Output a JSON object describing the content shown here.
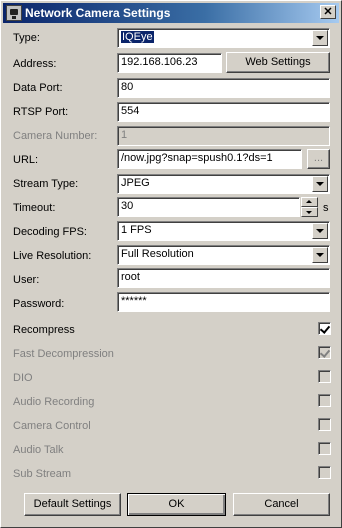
{
  "window": {
    "title": "Network Camera Settings",
    "close_glyph": "✕"
  },
  "fields": {
    "type": {
      "label": "Type:",
      "value": "IQEye"
    },
    "address": {
      "label": "Address:",
      "value": "192.168.106.23",
      "button": "Web Settings"
    },
    "data_port": {
      "label": "Data Port:",
      "value": "80"
    },
    "rtsp_port": {
      "label": "RTSP Port:",
      "value": "554"
    },
    "camera_number": {
      "label": "Camera Number:",
      "value": "1"
    },
    "url": {
      "label": "URL:",
      "value": "/now.jpg?snap=spush0.1?ds=1",
      "button": "..."
    },
    "stream_type": {
      "label": "Stream Type:",
      "value": "JPEG"
    },
    "timeout": {
      "label": "Timeout:",
      "value": "30",
      "unit": "s"
    },
    "decoding_fps": {
      "label": "Decoding FPS:",
      "value": "1 FPS"
    },
    "live_resolution": {
      "label": "Live Resolution:",
      "value": "Full Resolution"
    },
    "user": {
      "label": "User:",
      "value": "root"
    },
    "password": {
      "label": "Password:",
      "value": "******"
    }
  },
  "options": [
    {
      "label": "Recompress",
      "checked": true,
      "enabled": true
    },
    {
      "label": "Fast Decompression",
      "checked": true,
      "enabled": false
    },
    {
      "label": "DIO",
      "checked": false,
      "enabled": false
    },
    {
      "label": "Audio Recording",
      "checked": false,
      "enabled": false
    },
    {
      "label": "Camera Control",
      "checked": false,
      "enabled": false
    },
    {
      "label": "Audio Talk",
      "checked": false,
      "enabled": false
    },
    {
      "label": "Sub Stream",
      "checked": false,
      "enabled": false
    }
  ],
  "buttons": {
    "default_settings": "Default Settings",
    "ok": "OK",
    "cancel": "Cancel"
  },
  "icons": {
    "window_icon": "camera-icon",
    "close": "close-icon"
  },
  "colors": {
    "titlebar_start": "#0a246a",
    "titlebar_end": "#a6caf0",
    "selection": "#0a246a"
  }
}
